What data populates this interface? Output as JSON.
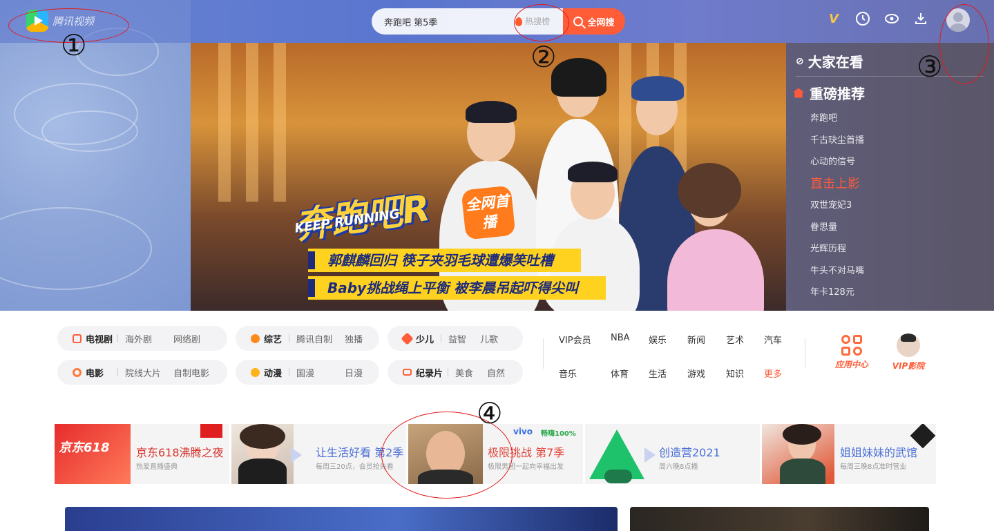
{
  "topbar": {
    "brand_name": "腾讯视频",
    "search_value": "奔跑吧 第5季",
    "hot_rank_label": "热搜榜",
    "search_button_label": "全网搜",
    "vip_icon_text": "V"
  },
  "hero": {
    "show_logo": "奔跑吧R",
    "show_logo_sub": "KEEP RUNNING",
    "badge": "全网首播",
    "caption_1": "郭麒麟回归 筷子夹羽毛球遭爆笑吐槽",
    "caption_2": "Baby挑战绳上平衡 被李晨吊起吓得尖叫"
  },
  "sidebar": {
    "header": "大家在看",
    "category": "重磅推荐",
    "items": [
      {
        "label": "奔跑吧",
        "hot": false
      },
      {
        "label": "千古玦尘首播",
        "hot": false
      },
      {
        "label": "心动的信号",
        "hot": false
      },
      {
        "label": "直击上影",
        "hot": true
      },
      {
        "label": "双世宠妃3",
        "hot": false
      },
      {
        "label": "眷思量",
        "hot": false
      },
      {
        "label": "光辉历程",
        "hot": false
      },
      {
        "label": "牛头不对马嘴",
        "hot": false
      },
      {
        "label": "年卡128元",
        "hot": false
      }
    ]
  },
  "annotations": [
    "①",
    "②",
    "③",
    "④"
  ],
  "categories": [
    {
      "main": "电视剧",
      "sub1": "海外剧",
      "sub2": "网络剧",
      "color": "#ff5c38"
    },
    {
      "main": "综艺",
      "sub1": "腾讯自制",
      "sub2": "独播",
      "color": "#ff8a1c"
    },
    {
      "main": "少儿",
      "sub1": "益智",
      "sub2": "儿歌",
      "color": "#ff5c38"
    },
    {
      "main": "电影",
      "sub1": "院线大片",
      "sub2": "自制电影",
      "color": "#ff7a3c"
    },
    {
      "main": "动漫",
      "sub1": "国漫",
      "sub2": "日漫",
      "color": "#ffb21c"
    },
    {
      "main": "纪录片",
      "sub1": "美食",
      "sub2": "自然",
      "color": "#ff5c38"
    }
  ],
  "quicklinks": [
    "VIP会员",
    "NBA",
    "娱乐",
    "新闻",
    "艺术",
    "汽车",
    "音乐",
    "体育",
    "生活",
    "游戏",
    "知识",
    "更多"
  ],
  "app_center_label": "应用中心",
  "vip_cinema_label": "VIP影院",
  "banners": [
    {
      "title": "京东618沸腾之夜",
      "sub": "热爱直播盛典",
      "color": "#d8322a",
      "logo": "京东618"
    },
    {
      "title": "让生活好看 第2季",
      "sub": "每周三20点，会员抢先看",
      "color": "#4a6fd4"
    },
    {
      "title": "极限挑战 第7季",
      "sub": "极限男团一起向幸福出发",
      "color": "#e0453a",
      "brand1": "vivo",
      "brand2": "畅嗨100%"
    },
    {
      "title": "创造营2021",
      "sub": "周六晚8点播",
      "color": "#4a6fd4"
    },
    {
      "title": "姐姐妹妹的武馆",
      "sub": "每周三晚8点准时营业",
      "color": "#4a6fd4"
    }
  ],
  "colors": {
    "accent": "#ff5c38",
    "annotation": "#e21b1b"
  }
}
